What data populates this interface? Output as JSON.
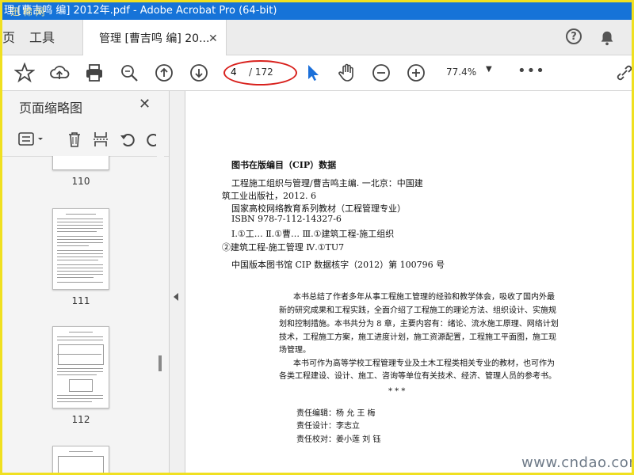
{
  "window": {
    "title": "理 [曹吉鸣 编] 2012年.pdf - Adobe Acrobat Pro (64-bit)"
  },
  "tabs": {
    "home_partial": "页",
    "tools": "工具",
    "doc_tab": "管理 [曹吉鸣 编] 20...",
    "close": "✕"
  },
  "toolbar": {
    "page_current": "4",
    "page_total": "/ 172",
    "zoom": "77.4%",
    "more": "•••",
    "help": "?"
  },
  "sidebar": {
    "title": "页面缩略图",
    "close": "✕",
    "thumb_labels": [
      "110",
      "111",
      "112"
    ]
  },
  "document": {
    "cip_heading": "图书在版编目（CIP）数据",
    "cip_lines": [
      "工程施工组织与管理/曹吉鸣主编. 一北京：中国建",
      "筑工业出版社，2012. 6",
      "国家高校网络教育系列教材（工程管理专业）",
      "ISBN 978-7-112-14327-6",
      "Ⅰ.①工…  Ⅱ.①曹…    Ⅲ.①建筑工程-施工组织",
      "②建筑工程-施工管理   Ⅳ.①TU7",
      "中国版本图书馆 CIP 数据核字（2012）第 100796 号"
    ],
    "summary_lines": [
      "本书总结了作者多年从事工程施工管理的经验和教学体会，吸收了国内外最",
      "新的研究成果和工程实践，全面介绍了工程施工的理论方法、组织设计、实施规",
      "划和控制措施。本书共分为 8 章，主要内容有：绪论、流水施工原理、网络计划",
      "技术，工程施工方案，施工进度计划，施工资源配置，工程施工平面图，施工现",
      "场管理。",
      "本书可作为高等学校工程管理专业及土木工程类相关专业的教材，也可作为",
      "各类工程建设、设计、施工、咨询等单位有关技术、经济、管理人员的参考书。"
    ],
    "stars": "*        *        *",
    "editors": [
      "责任编辑：杨    允    王    梅",
      "责任设计：李志立",
      "责任校对：姜小莲    刘    钰"
    ]
  },
  "watermark": {
    "bottom": "www.cndao.com",
    "top": "迅 棉 网"
  },
  "icons": [
    "star-icon",
    "upload-icon",
    "print-icon",
    "search-icon",
    "prev-page-icon",
    "next-page-icon",
    "select-cursor-icon",
    "hand-icon",
    "zoom-out-icon",
    "zoom-in-icon",
    "bell-icon",
    "share-icon",
    "thumbnail-options-icon",
    "delete-icon",
    "extract-icon",
    "undo-icon",
    "redo-icon"
  ],
  "colors": {
    "titlebar": "#1673d8",
    "frame": "#f0e020",
    "annotation": "#d8201c",
    "cursor": "#1a6fd9"
  }
}
